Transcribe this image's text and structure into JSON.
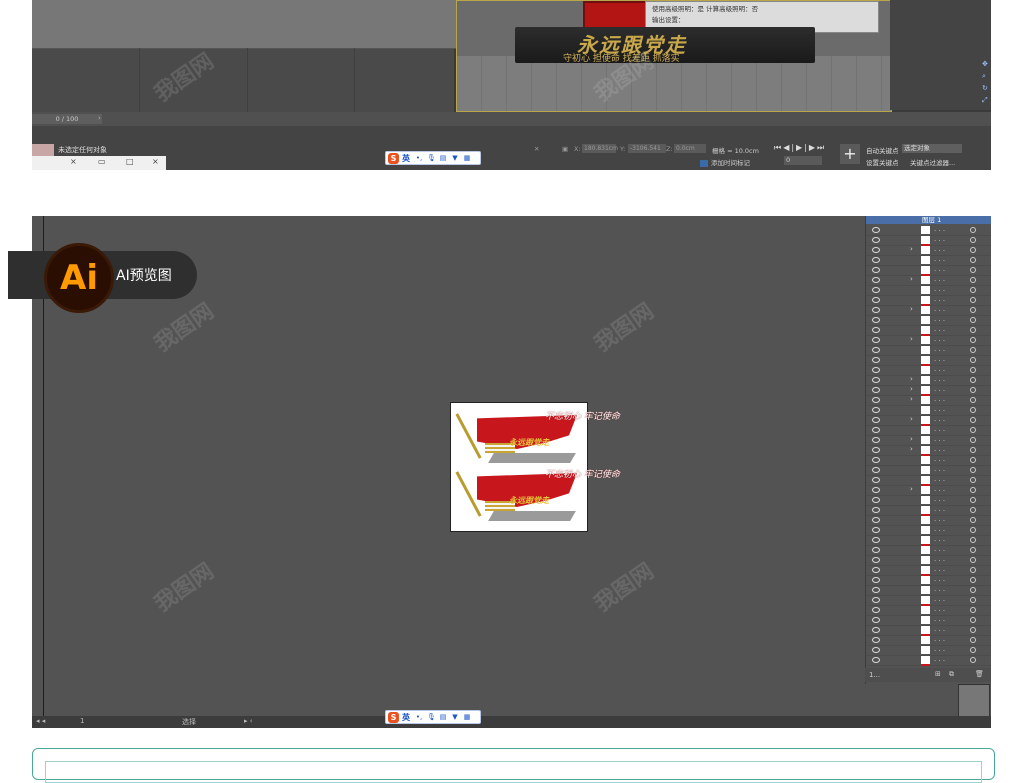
{
  "max_window": {
    "dialog_rows": [
      "使用高级照明：是     计算高级照明：否",
      "输出设置："
    ],
    "sign_title": "永远跟党走",
    "sign_subtitle": "守初心 担使命 找差距 抓落实",
    "time_slider": "0 / 100",
    "status_text": "未选定任何对象",
    "coord_x_label": "X:",
    "coord_x_value": "180.831cm",
    "coord_y_label": "Y:",
    "coord_y_value": "-3106.541",
    "coord_z_label": "Z:",
    "coord_z_value": "0.0cm",
    "grid": "栅格 = 10.0cm",
    "add_time_tag": "添加时间标记",
    "frame_value": "0",
    "auto_key": "自动关键点",
    "selection_dropdown": "选定对象",
    "set_key": "设置关键点",
    "key_filter": "关键点过滤器...",
    "playback": "⏮◀|▶|▶⏭"
  },
  "ime_toolbar": {
    "logo": "S",
    "language": "英",
    "icons": [
      "punctuation-icon",
      "microphone-icon",
      "keyboard-icon",
      "shirt-icon",
      "grid-icon"
    ]
  },
  "preview_tab": {
    "badge": "Ai",
    "label": "AI预览图"
  },
  "ai_window": {
    "layer_name": "图层 1",
    "layer_footer": "1...",
    "status_zoom": "1",
    "status_text": "选择",
    "billboard": {
      "title": "永远跟党走",
      "handwriting": "不忘初心 牢记使命"
    }
  },
  "watermark": "我图网",
  "colors": {
    "accent_red": "#c8161d",
    "accent_gold": "#c9a84a",
    "ai_orange": "#ff9a00",
    "teal_frame": "#4aa89a"
  }
}
